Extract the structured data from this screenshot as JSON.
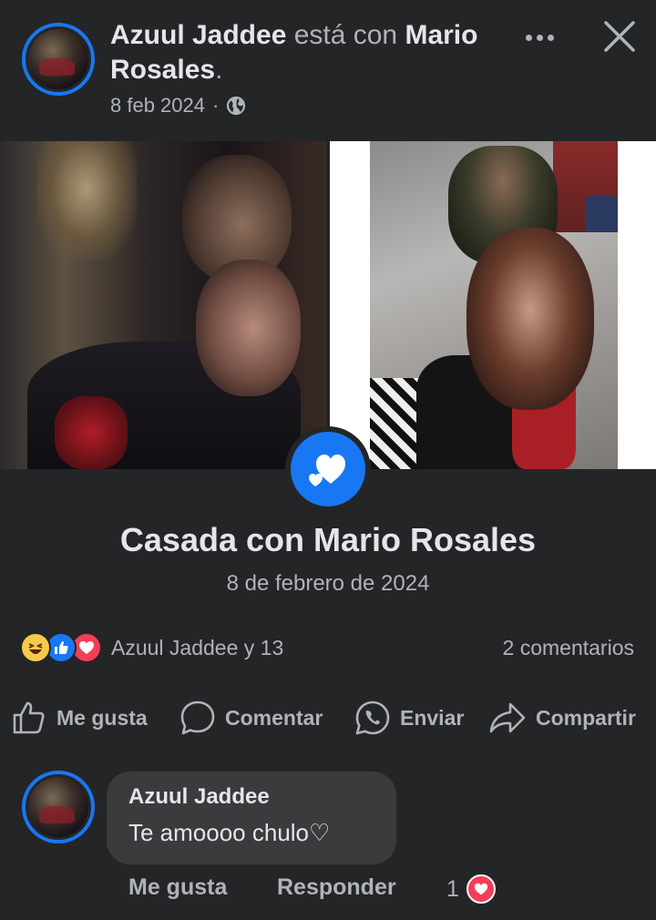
{
  "post": {
    "author": "Azuul Jaddee",
    "with_text": " está con ",
    "tagged": "Mario Rosales",
    "period": ".",
    "date": "8 feb 2024",
    "separator": "·",
    "privacy_icon": "globe-icon"
  },
  "event": {
    "title": "Casada con Mario Rosales",
    "date": "8 de febrero de 2024",
    "icon": "hearts-icon"
  },
  "reactions": {
    "types": [
      "haha",
      "like",
      "love"
    ],
    "summary": "Azuul Jaddee y 13",
    "comments": "2 comentarios"
  },
  "actions": {
    "like": "Me gusta",
    "comment": "Comentar",
    "send": "Enviar",
    "share": "Compartir"
  },
  "comment": {
    "author": "Azuul Jaddee",
    "text": "Te amoooo chulo♡",
    "like_label": "Me gusta",
    "reply_label": "Responder",
    "reaction_count": "1"
  },
  "colors": {
    "background": "#242526",
    "accent": "#1877f2",
    "love": "#f33e58",
    "haha": "#f7c94b",
    "bubble": "#3a3b3c"
  }
}
